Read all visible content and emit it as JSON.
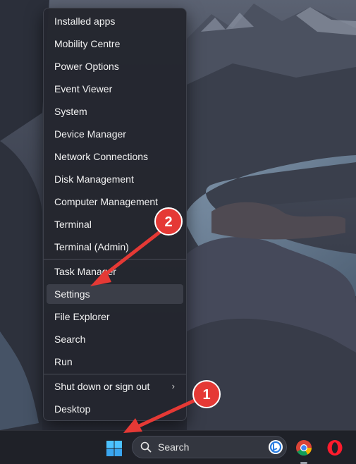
{
  "menu": {
    "items": [
      {
        "label": "Installed apps"
      },
      {
        "label": "Mobility Centre"
      },
      {
        "label": "Power Options"
      },
      {
        "label": "Event Viewer"
      },
      {
        "label": "System"
      },
      {
        "label": "Device Manager"
      },
      {
        "label": "Network Connections"
      },
      {
        "label": "Disk Management"
      },
      {
        "label": "Computer Management"
      },
      {
        "label": "Terminal"
      },
      {
        "label": "Terminal (Admin)"
      },
      {
        "label": "Task Manager"
      },
      {
        "label": "Settings"
      },
      {
        "label": "File Explorer"
      },
      {
        "label": "Search"
      },
      {
        "label": "Run"
      },
      {
        "label": "Shut down or sign out"
      },
      {
        "label": "Desktop"
      }
    ],
    "highlighted": "Settings"
  },
  "annotations": {
    "badge_1": "1",
    "badge_2": "2",
    "color": "#e53935"
  },
  "taskbar": {
    "search_placeholder": "Search",
    "icons": [
      "windows-start-icon",
      "search-icon",
      "bing-icon",
      "chrome-icon",
      "opera-icon"
    ]
  }
}
